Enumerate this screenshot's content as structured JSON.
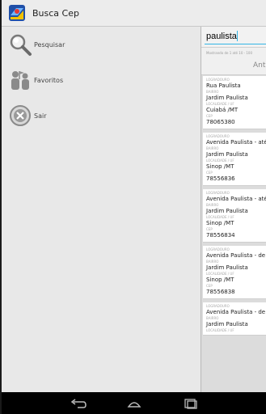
{
  "app": {
    "title": "Busca Cep",
    "icon": "map-pin-app-icon"
  },
  "drawer": {
    "items": [
      {
        "label": "Pesquisar",
        "icon": "magnifier-icon"
      },
      {
        "label": "Favoritos",
        "icon": "people-flag-icon"
      },
      {
        "label": "Sair",
        "icon": "close-circle-icon"
      }
    ]
  },
  "search": {
    "value": "paulista"
  },
  "pager": {
    "info": "Mostrando de 1 até 10 - 100",
    "prev_label": "Ant"
  },
  "labels": {
    "logradouro": "LOGRADOURO",
    "bairro": "BAIRRO",
    "localidade": "LOCALIDADE / UF",
    "cep": "CEP"
  },
  "results": [
    {
      "logradouro": "Rua Paulista",
      "bairro": "Jardim Paulista",
      "localidade": "Cuiabá /MT",
      "cep": "78065380"
    },
    {
      "logradouro": "Avenida Paulista - até",
      "bairro": "Jardim Paulista",
      "localidade": "Sinop /MT",
      "cep": "78556836"
    },
    {
      "logradouro": "Avenida Paulista - até",
      "bairro": "Jardim Paulista",
      "localidade": "Sinop /MT",
      "cep": "78556834"
    },
    {
      "logradouro": "Avenida Paulista - de",
      "bairro": "Jardim Paulista",
      "localidade": "Sinop /MT",
      "cep": "78556838"
    },
    {
      "logradouro": "Avenida Paulista - de",
      "bairro": "Jardim Paulista",
      "localidade": "",
      "cep": ""
    }
  ],
  "navbar": {
    "buttons": [
      "back-icon",
      "home-icon",
      "recents-icon"
    ]
  },
  "colors": {
    "accent": "#33b5e5",
    "drawer_bg": "#e8e8e8",
    "actionbar_bg": "#ececec"
  }
}
